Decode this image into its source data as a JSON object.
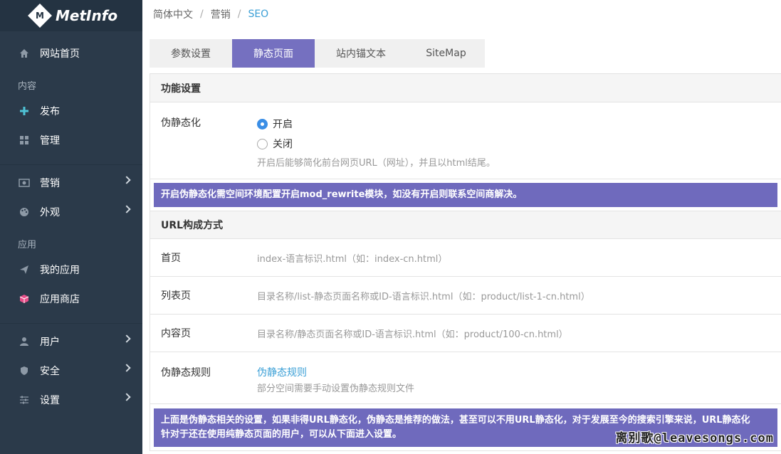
{
  "brand": {
    "logo_letter": "M",
    "name": "MetInfo"
  },
  "sidebar": {
    "home": "网站首页",
    "section_content": "内容",
    "publish": "发布",
    "manage": "管理",
    "marketing": "营销",
    "appearance": "外观",
    "section_apps": "应用",
    "my_apps": "我的应用",
    "app_store": "应用商店",
    "users": "用户",
    "security": "安全",
    "settings": "设置"
  },
  "breadcrumb": {
    "lang": "简体中文",
    "marketing": "营销",
    "current": "SEO"
  },
  "tabs": [
    "参数设置",
    "静态页面",
    "站内锚文本",
    "SiteMap"
  ],
  "active_tab": 1,
  "feature": {
    "heading": "功能设置",
    "pseudo_label": "伪静态化",
    "on": "开启",
    "off": "关闭",
    "hint": "开启后能够简化前台网页URL（网址），并且以html结尾。"
  },
  "notice1": "开启伪静态化需空间环境配置开启mod_rewrite模块，如没有开启则联系空间商解决。",
  "url": {
    "heading": "URL构成方式",
    "home_label": "首页",
    "home_val": "index-语言标识.html（如：index-cn.html）",
    "list_label": "列表页",
    "list_val": "目录名称/list-静态页面名称或ID-语言标识.html（如：product/list-1-cn.html）",
    "content_label": "内容页",
    "content_val": "目录名称/静态页面名称或ID-语言标识.html（如：product/100-cn.html）",
    "rule_label": "伪静态规则",
    "rule_link": "伪静态规则",
    "rule_hint": "部分空间需要手动设置伪静态规则文件"
  },
  "notice2_line1": "上面是伪静态相关的设置，如果非得URL静态化，伪静态是推荐的做法，甚至可以不用URL静态化，对于发展至今的搜索引擎来说，URL静态化",
  "notice2_line2": "针对于还在使用纯静态页面的用户，可以从下面进入设置。",
  "watermark": "离别歌@leavesongs.com",
  "colors": {
    "sidebar": "#2b3a4a",
    "accent": "#7570c0",
    "link": "#3a9fd6"
  }
}
